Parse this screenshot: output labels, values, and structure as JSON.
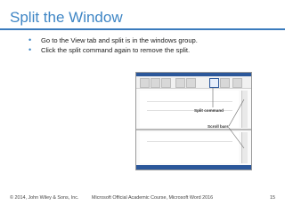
{
  "slide": {
    "title": "Split the Window",
    "bullets": [
      "Go to the View tab and split is in the windows group.",
      "Click the split command again to remove the split."
    ]
  },
  "screenshot": {
    "callouts": {
      "split_command": "Split command",
      "scroll_bars": "Scroll bars"
    }
  },
  "footer": {
    "copyright": "© 2014, John Wiley & Sons, Inc.",
    "course": "Microsoft Official Academic Course, Microsoft Word 2016",
    "page": "15"
  },
  "colors": {
    "title": "#3f86c5",
    "rule": "#3a7bbd",
    "word_blue": "#2b579a"
  }
}
